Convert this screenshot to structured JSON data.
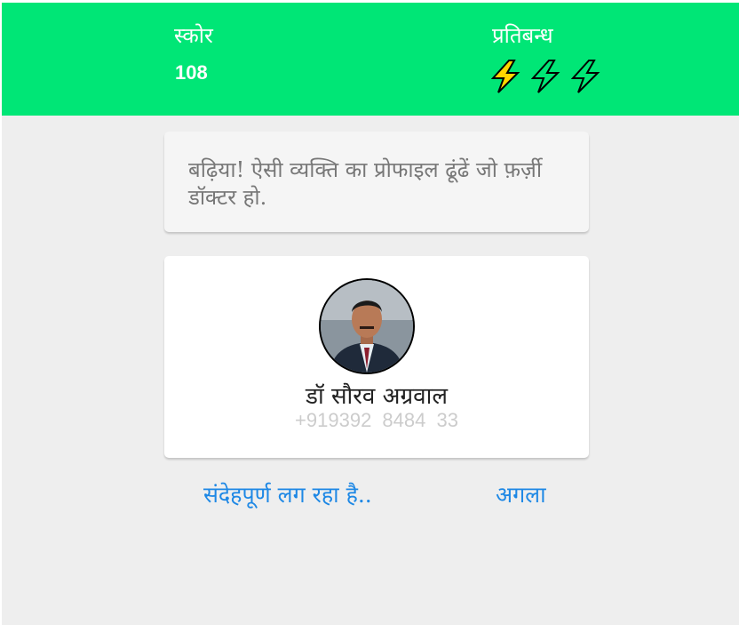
{
  "header": {
    "score_label": "स्कोर",
    "score_value": "108",
    "limit_label": "प्रतिबन्ध",
    "limit_icons": [
      "lightning-bolt-icon",
      "lightning-bolt-icon",
      "lightning-bolt-icon"
    ]
  },
  "message": {
    "text": "बढ़िया! ऐसी व्यक्ति का प्रोफाइल ढूंढें जो फ़र्ज़ी डॉक्टर हो."
  },
  "profile": {
    "name": "डॉ सौरव अग्रवाल",
    "phone": "+919392 8484 33"
  },
  "actions": {
    "suspicious_label": "संदेहपूर्ण लग रहा है..",
    "next_label": "अगला"
  },
  "colors": {
    "header_bg": "#00e676",
    "page_bg": "#eeeeee",
    "link": "#1e88e5",
    "bolt_fill": "#ffd600"
  }
}
